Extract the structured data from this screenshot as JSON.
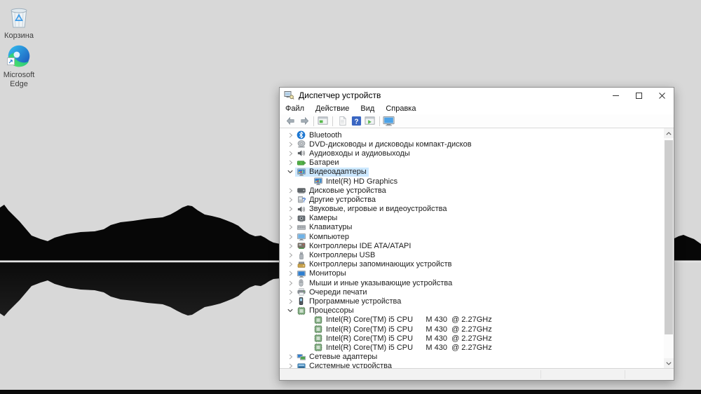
{
  "desktop": {
    "background_color": "#d8d8d8",
    "silhouette_color": "#070707",
    "icons": [
      {
        "label": "Корзина",
        "icon": "recycle-bin-icon"
      },
      {
        "label": "Microsoft Edge",
        "icon": "edge-logo-icon"
      }
    ]
  },
  "window": {
    "title": "Диспетчер устройств",
    "app_icon": "device-manager-icon",
    "controls": [
      "minimize",
      "maximize",
      "close"
    ],
    "menu": [
      "Файл",
      "Действие",
      "Вид",
      "Справка"
    ],
    "toolbar": [
      "back-arrow",
      "forward-arrow",
      "|",
      "show-console-tree",
      "|",
      "properties",
      "help",
      "show-window",
      "|",
      "scan-hardware-changes"
    ],
    "tree": {
      "items": [
        {
          "label": "Bluetooth",
          "icon": "bluetooth",
          "level": 1,
          "expander": "collapsed",
          "selected": false
        },
        {
          "label": "DVD-дисководы и дисководы компакт-дисков",
          "icon": "dvd-drive",
          "level": 1,
          "expander": "collapsed",
          "selected": false
        },
        {
          "label": "Аудиовходы и аудиовыходы",
          "icon": "audio-device",
          "level": 1,
          "expander": "collapsed",
          "selected": false
        },
        {
          "label": "Батареи",
          "icon": "battery",
          "level": 1,
          "expander": "collapsed",
          "selected": false
        },
        {
          "label": "Видеоадаптеры",
          "icon": "display-adapter",
          "level": 1,
          "expander": "expanded",
          "selected": true
        },
        {
          "label": "Intel(R) HD Graphics",
          "icon": "display-adapter",
          "level": 2,
          "expander": "none",
          "selected": false
        },
        {
          "label": "Дисковые устройства",
          "icon": "disk-drive",
          "level": 1,
          "expander": "collapsed",
          "selected": false
        },
        {
          "label": "Другие устройства",
          "icon": "unknown-device",
          "level": 1,
          "expander": "collapsed",
          "selected": false
        },
        {
          "label": "Звуковые, игровые и видеоустройства",
          "icon": "audio-device",
          "level": 1,
          "expander": "collapsed",
          "selected": false
        },
        {
          "label": "Камеры",
          "icon": "camera",
          "level": 1,
          "expander": "collapsed",
          "selected": false
        },
        {
          "label": "Клавиатуры",
          "icon": "keyboard",
          "level": 1,
          "expander": "collapsed",
          "selected": false
        },
        {
          "label": "Компьютер",
          "icon": "computer",
          "level": 1,
          "expander": "collapsed",
          "selected": false
        },
        {
          "label": "Контроллеры IDE ATA/ATAPI",
          "icon": "ide-controller",
          "level": 1,
          "expander": "collapsed",
          "selected": false
        },
        {
          "label": "Контроллеры USB",
          "icon": "usb-controller",
          "level": 1,
          "expander": "collapsed",
          "selected": false
        },
        {
          "label": "Контроллеры запоминающих устройств",
          "icon": "storage-controller",
          "level": 1,
          "expander": "collapsed",
          "selected": false
        },
        {
          "label": "Мониторы",
          "icon": "monitor",
          "level": 1,
          "expander": "collapsed",
          "selected": false
        },
        {
          "label": "Мыши и иные указывающие устройства",
          "icon": "mouse",
          "level": 1,
          "expander": "collapsed",
          "selected": false
        },
        {
          "label": "Очереди печати",
          "icon": "print-queue",
          "level": 1,
          "expander": "collapsed",
          "selected": false
        },
        {
          "label": "Программные устройства",
          "icon": "software-device",
          "level": 1,
          "expander": "collapsed",
          "selected": false
        },
        {
          "label": "Процессоры",
          "icon": "cpu",
          "level": 1,
          "expander": "expanded",
          "selected": false
        },
        {
          "label": "Intel(R) Core(TM) i5 CPU      M 430  @ 2.27GHz",
          "icon": "cpu",
          "level": 2,
          "expander": "none",
          "selected": false
        },
        {
          "label": "Intel(R) Core(TM) i5 CPU      M 430  @ 2.27GHz",
          "icon": "cpu",
          "level": 2,
          "expander": "none",
          "selected": false
        },
        {
          "label": "Intel(R) Core(TM) i5 CPU      M 430  @ 2.27GHz",
          "icon": "cpu",
          "level": 2,
          "expander": "none",
          "selected": false
        },
        {
          "label": "Intel(R) Core(TM) i5 CPU      M 430  @ 2.27GHz",
          "icon": "cpu",
          "level": 2,
          "expander": "none",
          "selected": false
        },
        {
          "label": "Сетевые адаптеры",
          "icon": "network-adapter",
          "level": 1,
          "expander": "collapsed",
          "selected": false
        },
        {
          "label": "Системные устройства",
          "icon": "system-device",
          "level": 1,
          "expander": "collapsed",
          "selected": false
        }
      ]
    }
  },
  "colors": {
    "selection_highlight": "#cce8ff",
    "help_icon_bg": "#3a66c2",
    "window_background": "#ffffff"
  }
}
